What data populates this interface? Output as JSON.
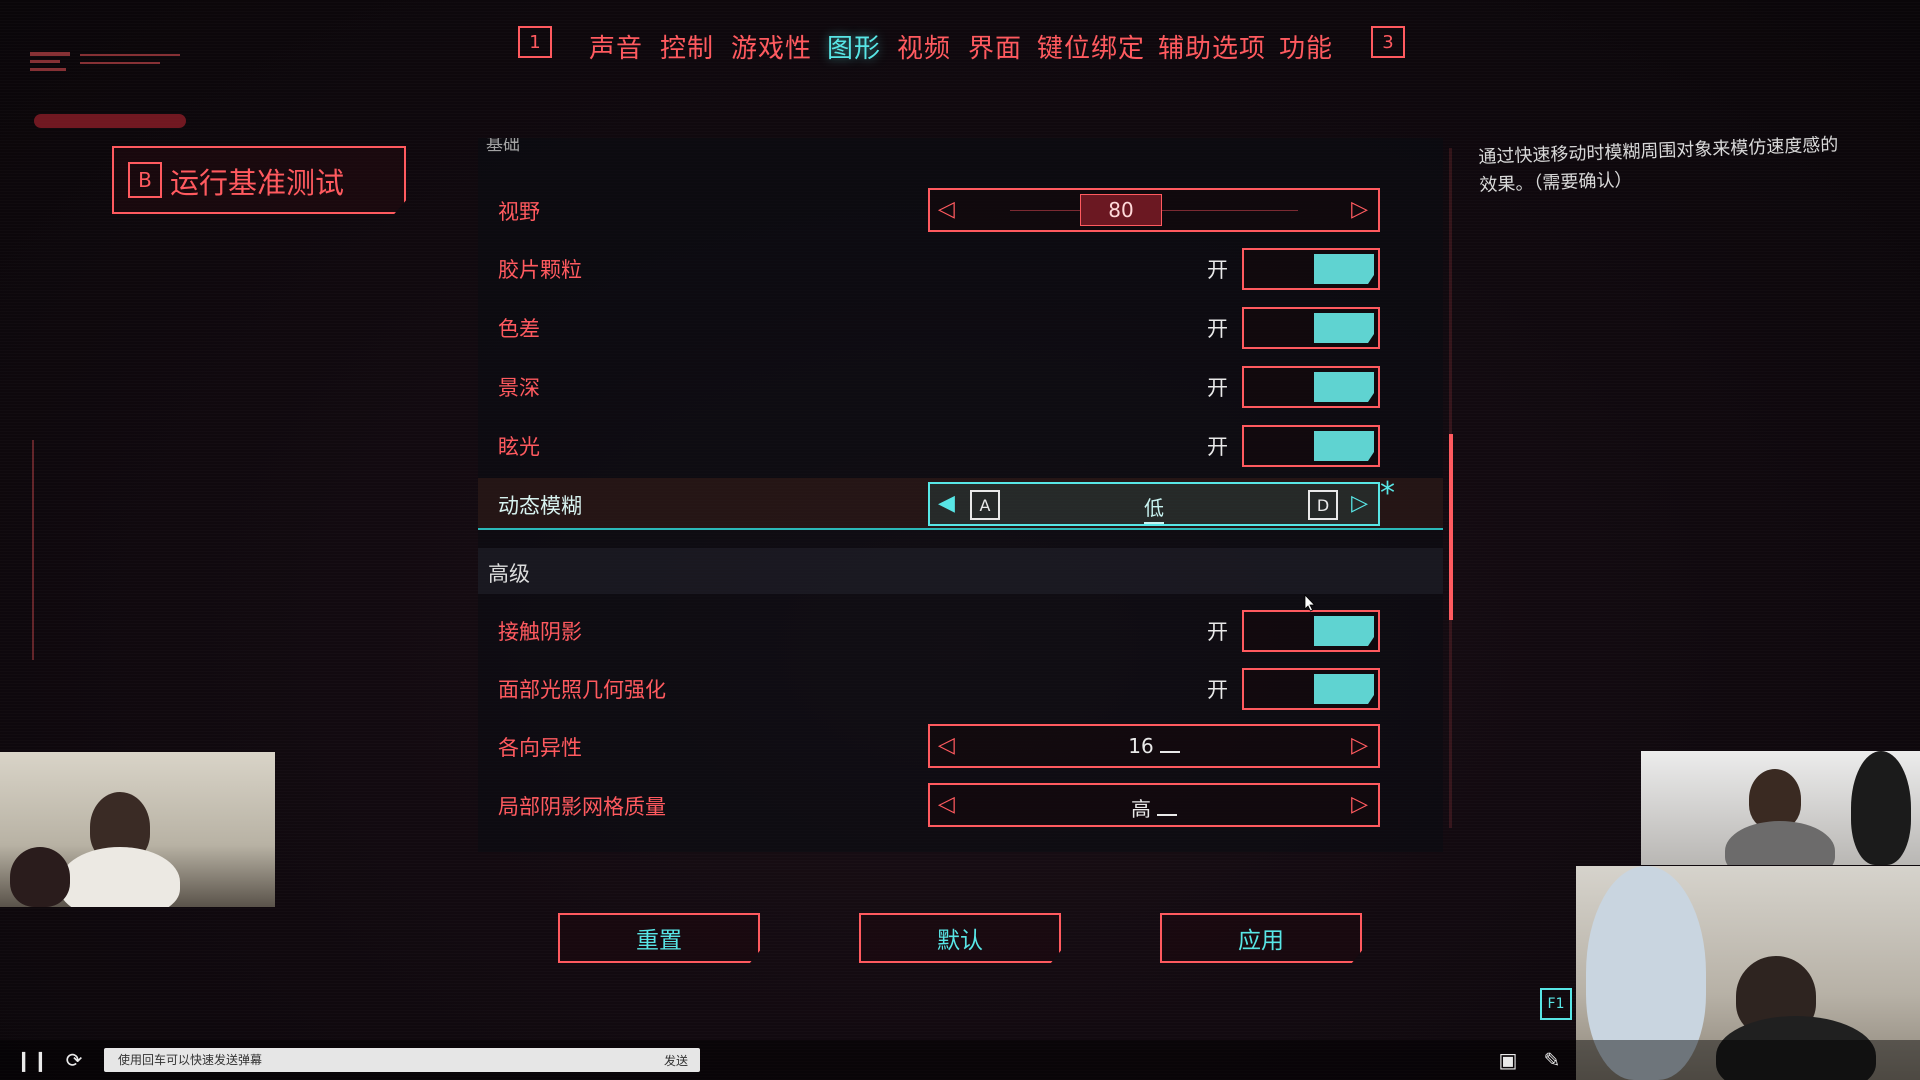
{
  "top_tabs": {
    "left_key": "1",
    "right_key": "3",
    "tabs": [
      "声音",
      "控制",
      "游戏性",
      "图形",
      "视频",
      "界面",
      "键位绑定",
      "辅助选项",
      "功能"
    ],
    "active": "图形"
  },
  "benchmark": {
    "key": "B",
    "label": "运行基准测试"
  },
  "panel": {
    "cut_off_section": "基础",
    "rows": [
      {
        "label": "视野",
        "type": "slider",
        "value": "80"
      },
      {
        "label": "胶片颗粒",
        "type": "toggle",
        "state": "开"
      },
      {
        "label": "色差",
        "type": "toggle",
        "state": "开"
      },
      {
        "label": "景深",
        "type": "toggle",
        "state": "开"
      },
      {
        "label": "眩光",
        "type": "toggle",
        "state": "开"
      },
      {
        "label": "动态模糊",
        "type": "selector",
        "value": "低",
        "key_left": "A",
        "key_right": "D",
        "modified_marker": "*"
      }
    ],
    "advanced_header": "高级",
    "advanced_rows": [
      {
        "label": "接触阴影",
        "type": "toggle",
        "state": "开"
      },
      {
        "label": "面部光照几何强化",
        "type": "toggle",
        "state": "开"
      },
      {
        "label": "各向异性",
        "type": "selector",
        "value": "16"
      },
      {
        "label": "局部阴影网格质量",
        "type": "selector",
        "value": "高"
      }
    ]
  },
  "description": "通过快速移动时模糊周围对象来模仿速度感的效果。（需要确认）",
  "buttons": {
    "reset": "重置",
    "default": "默认",
    "apply": "应用"
  },
  "help_key": "F1",
  "chat": {
    "placeholder": "使用回车可以快速发送弹幕",
    "send": "发送"
  },
  "colors": {
    "accent_red": "#ff5a5f",
    "accent_cyan": "#58e6e6",
    "toggle_fill": "#5fd3d1"
  }
}
